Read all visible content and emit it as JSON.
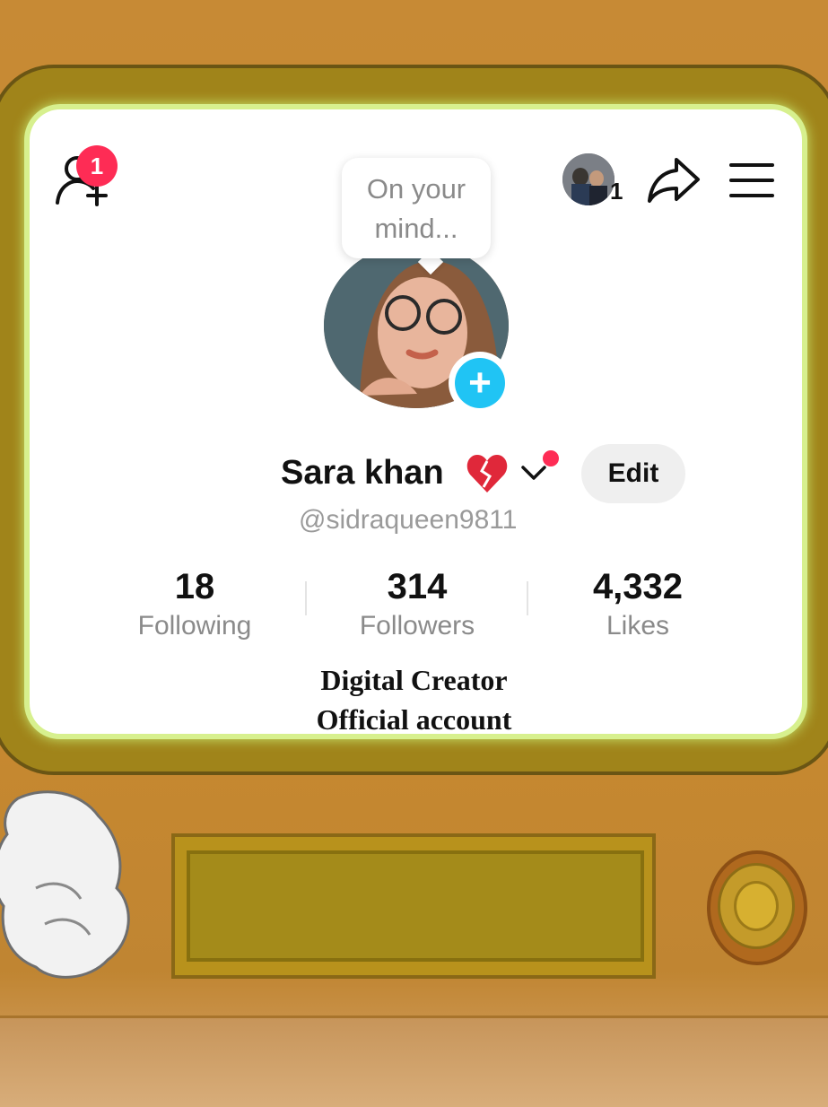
{
  "profile": {
    "notification_count": "1",
    "story_prompt": "On your mind...",
    "story_prompt_line1": "On your",
    "story_prompt_line2": "mind...",
    "switch_account_count": "1",
    "display_name": "Sara khan",
    "username": "@sidraqueen9811",
    "edit_label": "Edit",
    "stats": [
      {
        "value": "18",
        "label": "Following"
      },
      {
        "value": "314",
        "label": "Followers"
      },
      {
        "value": "4,332",
        "label": "Likes"
      }
    ],
    "bio_line1": "Digital Creator",
    "bio_line2": "Official account"
  },
  "colors": {
    "accent_red": "#fe2c55",
    "story_add": "#20c4f4"
  },
  "icons": [
    "add-friend-icon",
    "share-icon",
    "menu-icon",
    "broken-heart-icon",
    "chevron-down-icon",
    "plus-icon"
  ]
}
